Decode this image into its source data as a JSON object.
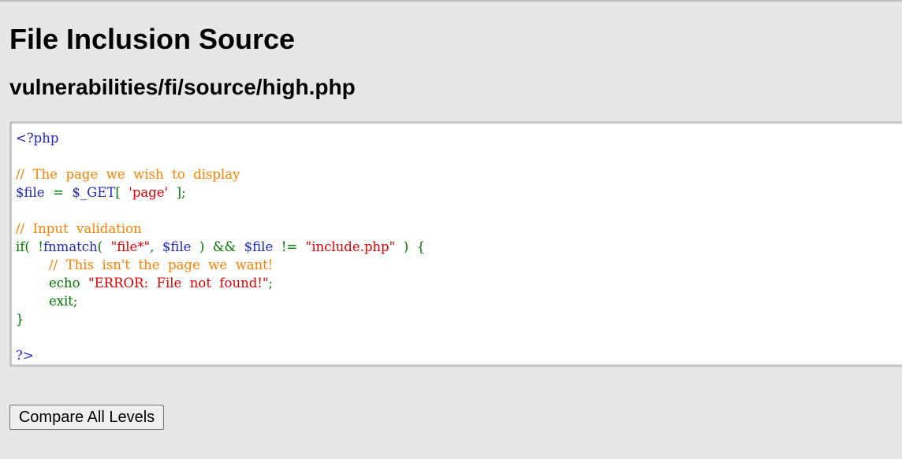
{
  "page": {
    "title": "File Inclusion Source",
    "subtitle": "vulnerabilities/fi/source/high.php"
  },
  "colors": {
    "default": "#1f28b8",
    "comment": "#ff8000",
    "keyword": "#007700",
    "string": "#dd0000"
  },
  "code": {
    "lines": [
      [
        {
          "t": "<?php",
          "c": "default"
        }
      ],
      [],
      [
        {
          "t": "//  The  page  we  wish  to  display",
          "c": "comment"
        }
      ],
      [
        {
          "t": "$file",
          "c": "default"
        },
        {
          "t": "  =  ",
          "c": "keyword"
        },
        {
          "t": "$_GET",
          "c": "default"
        },
        {
          "t": "[  ",
          "c": "keyword"
        },
        {
          "t": "'page'",
          "c": "string"
        },
        {
          "t": "  ];",
          "c": "keyword"
        }
      ],
      [],
      [
        {
          "t": "//  Input  validation",
          "c": "comment"
        }
      ],
      [
        {
          "t": "if(  !",
          "c": "keyword"
        },
        {
          "t": "fnmatch",
          "c": "default"
        },
        {
          "t": "(  ",
          "c": "keyword"
        },
        {
          "t": "\"file*\"",
          "c": "string"
        },
        {
          "t": ",  ",
          "c": "keyword"
        },
        {
          "t": "$file",
          "c": "default"
        },
        {
          "t": "  )  &&  ",
          "c": "keyword"
        },
        {
          "t": "$file",
          "c": "default"
        },
        {
          "t": "  !=  ",
          "c": "keyword"
        },
        {
          "t": "\"include.php\"",
          "c": "string"
        },
        {
          "t": "  )  {",
          "c": "keyword"
        }
      ],
      [
        {
          "t": "        ",
          "c": "keyword"
        },
        {
          "t": "//  This  isn't  the  page  we  want!",
          "c": "comment"
        }
      ],
      [
        {
          "t": "        echo  ",
          "c": "keyword"
        },
        {
          "t": "\"ERROR:  File  not  found!\"",
          "c": "string"
        },
        {
          "t": ";",
          "c": "keyword"
        }
      ],
      [
        {
          "t": "        exit;",
          "c": "keyword"
        }
      ],
      [
        {
          "t": "}",
          "c": "keyword"
        }
      ],
      [],
      [
        {
          "t": "?>",
          "c": "default"
        }
      ]
    ]
  },
  "buttons": {
    "compare_label": "Compare All Levels"
  }
}
